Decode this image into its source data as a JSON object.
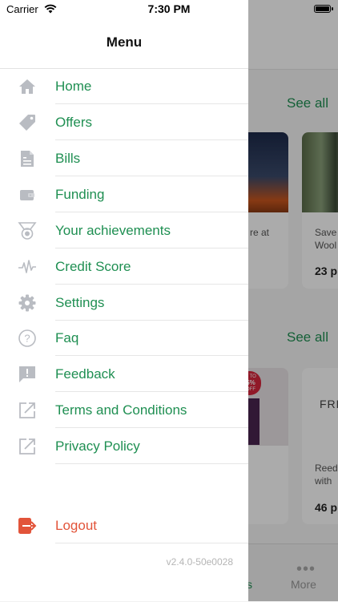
{
  "status_bar": {
    "carrier": "Carrier",
    "time": "7:30 PM"
  },
  "menu": {
    "title": "Menu",
    "items": [
      {
        "label": "Home",
        "icon": "home-icon"
      },
      {
        "label": "Offers",
        "icon": "tag-icon"
      },
      {
        "label": "Bills",
        "icon": "bill-icon"
      },
      {
        "label": "Funding",
        "icon": "wallet-icon"
      },
      {
        "label": "Your achievements",
        "icon": "medal-icon"
      },
      {
        "label": "Credit Score",
        "icon": "pulse-icon"
      },
      {
        "label": "Settings",
        "icon": "gear-icon"
      },
      {
        "label": "Faq",
        "icon": "question-icon"
      },
      {
        "label": "Feedback",
        "icon": "feedback-icon"
      },
      {
        "label": "Terms and Conditions",
        "icon": "external-link-icon"
      },
      {
        "label": "Privacy Policy",
        "icon": "external-link-icon"
      }
    ],
    "logout": {
      "label": "Logout",
      "icon": "logout-icon"
    },
    "version": "v2.4.0-50e0028"
  },
  "background": {
    "see_all_1": "See all",
    "see_all_2": "See all",
    "card1_text": "re at",
    "card2_text_1": "Save",
    "card2_text_2": "Wool",
    "card2_points": "23 p",
    "card3_badge_1": "P TO",
    "card3_badge_2": "5%",
    "card3_badge_3": "OFF",
    "card4_text_top": "FRE",
    "card4_text_1": "Reed",
    "card4_text_2": "with",
    "card4_points": "46 p",
    "tab_partial": "s",
    "tab_more": "More"
  },
  "colors": {
    "accent": "#1f8f52",
    "logout": "#e2543a",
    "icon_gray": "#b9bcc2"
  }
}
